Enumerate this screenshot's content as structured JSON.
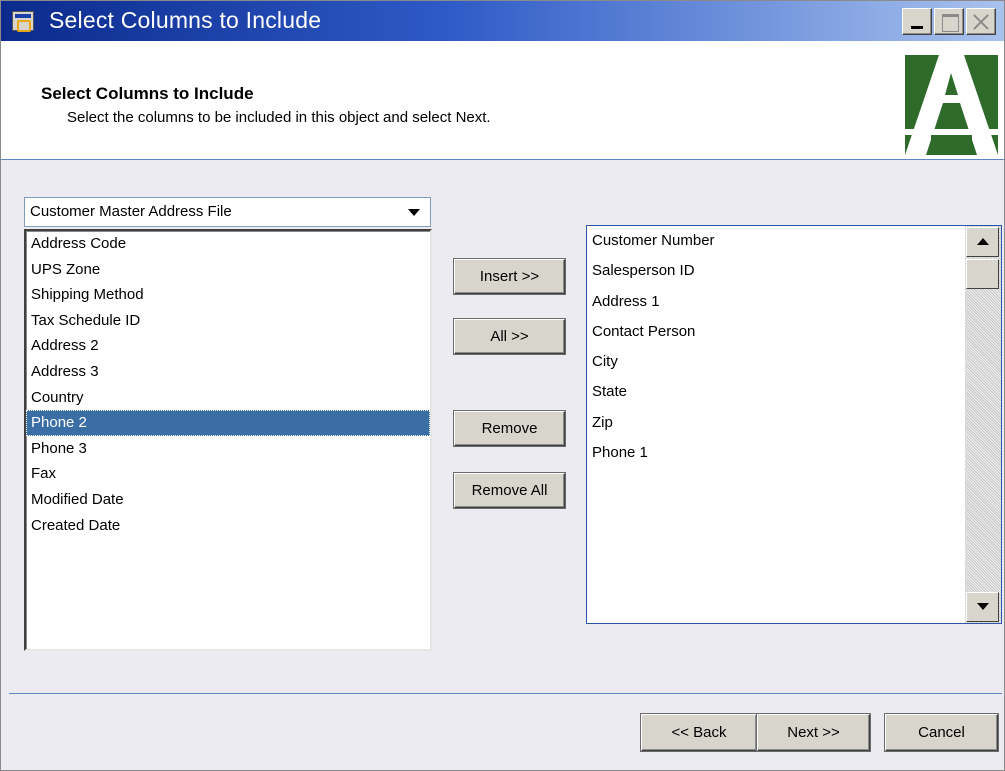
{
  "window": {
    "title": "Select Columns to Include"
  },
  "header": {
    "title": "Select Columns to Include",
    "subtitle": "Select the columns to be included in this object and select Next."
  },
  "source_table": {
    "selected": "Customer Master Address File"
  },
  "available_columns": [
    "Address Code",
    "UPS Zone",
    "Shipping Method",
    "Tax Schedule ID",
    "Address 2",
    "Address 3",
    "Country",
    "Phone 2",
    "Phone 3",
    "Fax",
    "Modified Date",
    "Created Date"
  ],
  "selected_available_index": 7,
  "included_columns": [
    "Customer Number",
    "Salesperson ID",
    "Address 1",
    "Contact Person",
    "City",
    "State",
    "Zip",
    "Phone 1"
  ],
  "buttons": {
    "insert": "Insert >>",
    "all": "All >>",
    "remove": "Remove",
    "remove_all": "Remove All",
    "back": "<< Back",
    "next": "Next >>",
    "cancel": "Cancel"
  },
  "colors": {
    "title_bar_start": "#0b2a8c",
    "selection": "#3a6ea5",
    "logo_green": "#2e6b2a"
  }
}
